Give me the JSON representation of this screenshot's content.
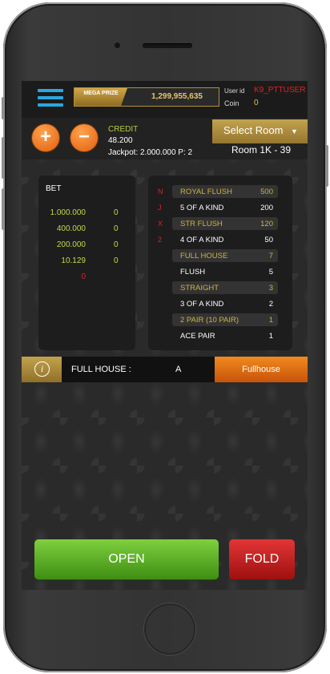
{
  "header": {
    "mega_badge": "MEGA PRIZE",
    "mega_value": "1,299,955,635",
    "user_id_label": "User id",
    "user_id": "K9_PTTUSER",
    "coin_label": "Coin",
    "coin_value": "0"
  },
  "controls": {
    "plus": "+",
    "minus": "−",
    "credit_label": "CREDIT",
    "credit_value": "48.200",
    "jackpot_text": "Jackpot: 2.000.000   P: 2",
    "select_room": "Select Room",
    "room": "Room 1K - 39"
  },
  "bet": {
    "title": "BET",
    "rows": [
      {
        "amount": "1.000.000",
        "count": "0"
      },
      {
        "amount": "400.000",
        "count": "0"
      },
      {
        "amount": "200.000",
        "count": "0"
      },
      {
        "amount": "10.129",
        "count": "0"
      }
    ],
    "extra": "0"
  },
  "paytable": {
    "side_letters": [
      "N",
      "J",
      "X",
      "2"
    ],
    "rows": [
      {
        "name": "ROYAL FLUSH",
        "value": "500"
      },
      {
        "name": "5 OF A KIND",
        "value": "200"
      },
      {
        "name": "STR FLUSH",
        "value": "120"
      },
      {
        "name": "4 OF A KIND",
        "value": "50"
      },
      {
        "name": "FULL HOUSE",
        "value": "7"
      },
      {
        "name": "FLUSH",
        "value": "5"
      },
      {
        "name": "STRAIGHT",
        "value": "3"
      },
      {
        "name": "3 OF A KIND",
        "value": "2"
      },
      {
        "name": "2 PAIR (10 PAIR)",
        "value": "1"
      },
      {
        "name": "ACE PAIR",
        "value": "1"
      }
    ]
  },
  "result": {
    "info": "i",
    "label": "FULL HOUSE :",
    "value": "A",
    "button": "Fullhouse"
  },
  "actions": {
    "open": "OPEN",
    "fold": "FOLD"
  },
  "colors": {
    "accent_gold": "#c2a34d",
    "accent_orange": "#e0600f",
    "credit_green": "#b9cc3c",
    "open_green": "#5fb52a",
    "fold_red": "#c81f1f",
    "user_red": "#e82020"
  }
}
